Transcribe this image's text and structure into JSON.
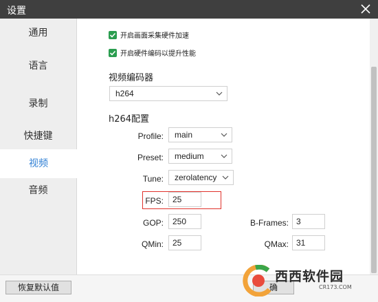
{
  "window": {
    "title": "设置"
  },
  "sidebar": {
    "items": [
      {
        "label": "通用"
      },
      {
        "label": "语言"
      },
      {
        "label": "录制"
      },
      {
        "label": "快捷键"
      },
      {
        "label": "视频",
        "active": true
      },
      {
        "label": "音频"
      }
    ]
  },
  "video": {
    "hw_capture_label": "开启画面采集硬件加速",
    "hw_capture_checked": true,
    "hw_encode_label": "开启硬件编码以提升性能",
    "hw_encode_checked": true,
    "encoder_section_label": "视频编码器",
    "encoder_value": "h264",
    "h264_section_label": "h264配置",
    "profile_label": "Profile:",
    "profile_value": "main",
    "preset_label": "Preset:",
    "preset_value": "medium",
    "tune_label": "Tune:",
    "tune_value": "zerolatency",
    "fps_label": "FPS:",
    "fps_value": "25",
    "gop_label": "GOP:",
    "gop_value": "250",
    "bframes_label": "B-Frames:",
    "bframes_value": "3",
    "qmin_label": "QMin:",
    "qmin_value": "25",
    "qmax_label": "QMax:",
    "qmax_value": "31"
  },
  "footer": {
    "reset_label": "恢复默认值",
    "ok_label": "确"
  },
  "watermark": {
    "text": "西西软件园",
    "sub": "CR173.COM"
  },
  "colors": {
    "titlebar": "#3f3f3f",
    "accent": "#2f7fd4",
    "checkbox": "#2a9d4f",
    "highlight": "#e0302a"
  },
  "icons": {
    "close": "close-icon",
    "checkmark": "checkmark-icon",
    "dropdown": "chevron-down-icon"
  }
}
